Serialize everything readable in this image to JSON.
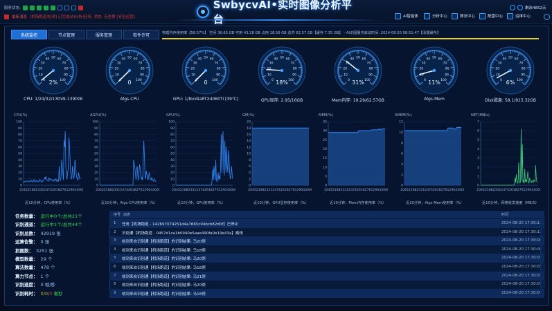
{
  "topbar": {
    "service_status_label": "服务状态:",
    "alarm_label": "最新消息",
    "alarm_text": "[机场跑道/检测] 已完成[AI分析]任务, 状态: 无告警 [安全运营]",
    "title": "SwbycvAI•实时图像分析平台",
    "nav": [
      {
        "label": "AI智能体",
        "icon": "robot-icon"
      },
      {
        "label": "分析中心",
        "icon": "chart-icon"
      },
      {
        "label": "算法中心",
        "icon": "algorithm-icon"
      },
      {
        "label": "配置中心",
        "icon": "settings-icon"
      },
      {
        "label": "运维中心",
        "icon": "monitor-icon"
      }
    ],
    "user_label": "剩余4852天",
    "help_icon": "help-icon",
    "power_icon": "power-icon"
  },
  "tabs": [
    "系统监控",
    "节点管理",
    "服务管理",
    "软件许可"
  ],
  "active_tab": 0,
  "info_line": "物理内存使用率【58.57%】 空闲 36.65 GB 可用 43.28 GB 占用 18.56 GB 总共 62.57 GB【缓存 7.35 GB】 - AI识图服务启动时间: 2024-08-20 08:51:47【清理缓存】",
  "gauges": [
    {
      "label": "CPU: 1/24/32/13thi9-13900K",
      "value": 2,
      "display": "2%"
    },
    {
      "label": "Algs-CPU",
      "value": 0,
      "display": "0"
    },
    {
      "label": "GPU: 1/NvidiaRTX4060Ti [39℃]",
      "value": 0,
      "display": "0"
    },
    {
      "label": "GPU显存: 2.95/16GB",
      "value": 18,
      "display": "18%"
    },
    {
      "label": "Mem内存: 19.29/62.57GB",
      "value": 31,
      "display": "31%"
    },
    {
      "label": "Algs-Mem",
      "value": 11,
      "display": "11%"
    },
    {
      "label": "Disk磁盘: 58.1/915.32GB",
      "value": 6,
      "display": "6%"
    }
  ],
  "gauge_ticks": [
    0,
    10,
    20,
    30,
    40,
    50,
    60,
    70,
    80,
    90,
    100
  ],
  "colors": {
    "accent": "#2e8bff",
    "line_blue": "#2f8cff",
    "line_green": "#3fd07a",
    "ok": "#39d353",
    "warn": "#f0a020",
    "danger": "#e04040"
  },
  "chart_data": [
    {
      "type": "line",
      "title": "CPU(%)",
      "xlabel": "近10分钟，CPU使用率（%）",
      "x_ticks": [
        "2045",
        "2188",
        "2331",
        "2474",
        "2618",
        "2761",
        "2904",
        "3000"
      ],
      "ylim": [
        0,
        100
      ],
      "y_ticks": [
        0,
        10,
        20,
        30,
        40,
        50,
        60,
        70,
        80,
        90,
        100
      ],
      "series": [
        {
          "values": [
            6,
            5,
            6,
            5,
            6,
            7,
            6,
            5,
            6,
            7,
            6,
            5,
            8,
            7,
            6,
            5,
            7,
            9,
            6,
            5,
            6,
            8,
            7,
            5,
            6,
            7,
            6,
            9,
            8,
            6,
            5,
            7,
            6,
            8,
            9,
            12,
            10,
            14,
            9,
            8,
            7,
            6,
            12,
            9,
            8,
            10,
            9,
            8,
            7,
            6,
            8,
            9,
            7,
            10,
            9,
            6,
            8,
            7,
            6,
            30,
            10,
            8,
            12,
            40,
            30,
            20,
            8,
            70,
            60,
            85,
            30,
            12,
            10,
            20,
            25,
            75,
            65,
            40,
            20,
            10,
            12,
            30,
            20,
            10,
            15,
            40,
            35,
            20,
            12,
            10,
            8,
            20,
            15,
            10,
            12
          ]
        }
      ]
    },
    {
      "type": "line",
      "title": "AGPU(%)",
      "xlabel": "近10分钟，Algs-CPU使用率（%）",
      "x_ticks": [
        "2045",
        "2188",
        "2331",
        "2474",
        "2618",
        "2761",
        "2904",
        "3000"
      ],
      "ylim": [
        0,
        100
      ],
      "y_ticks": [
        0,
        10,
        20,
        30,
        40,
        50,
        60,
        70,
        80,
        90,
        100
      ],
      "series": [
        {
          "values": [
            0,
            0,
            0,
            0,
            0,
            0,
            0,
            0,
            0,
            0,
            0,
            0,
            0,
            0,
            0,
            0,
            0,
            0,
            0,
            0,
            0,
            0,
            0,
            0,
            0,
            0,
            0,
            0,
            0,
            0,
            0,
            0,
            0,
            0,
            0,
            0,
            0,
            0,
            0,
            0,
            0,
            0,
            0,
            0,
            0,
            0,
            0,
            0,
            0,
            0,
            0,
            0,
            0,
            0,
            0,
            0,
            40,
            35,
            28,
            20,
            8,
            25,
            30,
            15,
            8,
            20,
            33,
            25,
            18,
            10,
            12,
            8,
            40,
            70,
            45,
            15,
            10,
            22,
            18,
            12,
            8,
            15,
            20,
            12,
            10,
            8,
            12,
            10,
            8,
            6,
            10,
            8,
            7,
            6,
            5
          ]
        }
      ]
    },
    {
      "type": "line",
      "title": "GPU(%)",
      "xlabel": "近10分钟，GPU使用率（%）",
      "x_ticks": [
        "2045",
        "2188",
        "2331",
        "2474",
        "2618",
        "2761",
        "2904",
        "3000"
      ],
      "ylim": [
        0,
        100
      ],
      "y_ticks": [
        0,
        10,
        20,
        30,
        40,
        50,
        60,
        70,
        80,
        90,
        100
      ],
      "series": [
        {
          "values": [
            0,
            0,
            0,
            0,
            0,
            0,
            0,
            0,
            0,
            0,
            0,
            0,
            0,
            0,
            0,
            0,
            0,
            0,
            0,
            0,
            0,
            0,
            0,
            0,
            0,
            0,
            0,
            0,
            0,
            0,
            0,
            0,
            0,
            0,
            0,
            0,
            0,
            0,
            0,
            0,
            0,
            0,
            0,
            0,
            0,
            0,
            0,
            0,
            0,
            0,
            0,
            0,
            0,
            0,
            0,
            0,
            0,
            0,
            0,
            0,
            10,
            25,
            8,
            30,
            20,
            8,
            40,
            10,
            5,
            12,
            20,
            8,
            15,
            10,
            30,
            80,
            20,
            60,
            85,
            30,
            15,
            70,
            40,
            20,
            60,
            30,
            20,
            55,
            40,
            20,
            10,
            15,
            30,
            18,
            10
          ]
        }
      ]
    },
    {
      "type": "area",
      "title": "GM(%)",
      "xlabel": "近10分钟，GPU显存使用率（%）",
      "x_ticks": [
        "2045",
        "2188",
        "2331",
        "2474",
        "2618",
        "2761",
        "2904",
        "3000"
      ],
      "ylim": [
        0,
        20
      ],
      "y_ticks": [
        0,
        2,
        4,
        6,
        8,
        10,
        12,
        14,
        16,
        18,
        20
      ],
      "series": [
        {
          "values": [
            18,
            18,
            18,
            18,
            18,
            18,
            18,
            18,
            18,
            18,
            18,
            18,
            18,
            18,
            18,
            18,
            18,
            18,
            18,
            18,
            18,
            18,
            18,
            18,
            18,
            18,
            18,
            18,
            18,
            18,
            18,
            18,
            18,
            18,
            18,
            18,
            18,
            18,
            18,
            18
          ]
        }
      ]
    },
    {
      "type": "area",
      "title": "MEM(%)",
      "xlabel": "近10分钟，Mem内存使用率（%）",
      "x_ticks": [
        "2045",
        "2188",
        "2331",
        "2474",
        "2618",
        "2761",
        "2904",
        "3000"
      ],
      "ylim": [
        0,
        35
      ],
      "y_ticks": [
        0,
        5,
        10,
        15,
        20,
        25,
        30,
        35
      ],
      "series": [
        {
          "values": [
            29,
            29,
            29,
            29,
            29,
            29,
            29,
            29,
            29,
            29,
            29,
            29,
            29,
            29,
            29,
            29,
            29,
            29,
            29,
            29,
            29,
            30,
            30,
            30,
            30,
            30,
            30,
            30,
            30,
            30,
            30.5,
            30.5,
            30.5,
            30.5,
            30.5,
            31,
            30.5,
            31,
            31,
            31
          ]
        }
      ]
    },
    {
      "type": "area",
      "title": "AMEM(%)",
      "xlabel": "近10分钟，Algs-Mem使用率（%）",
      "x_ticks": [
        "2045",
        "2188",
        "2331",
        "2474",
        "2618",
        "2761",
        "2904",
        "3000"
      ],
      "ylim": [
        0,
        12
      ],
      "y_ticks": [
        0,
        2,
        4,
        6,
        8,
        10,
        12
      ],
      "series": [
        {
          "values": [
            10.3,
            10.3,
            10.3,
            10.3,
            10.3,
            10.3,
            10.3,
            10.3,
            10.3,
            10.3,
            10.3,
            10.3,
            10.3,
            10.3,
            10.3,
            10.3,
            10.3,
            10.3,
            10.3,
            10.3,
            10.3,
            10.3,
            10.3,
            10.3,
            10.3,
            10.3,
            10.3,
            10.3,
            10.3,
            10.3,
            10.8,
            10.8,
            10.8,
            10.8,
            10.6,
            10.6,
            10.9,
            10.9,
            10.9,
            10.9
          ]
        }
      ]
    },
    {
      "type": "line",
      "title": "NET(MB/s)",
      "xlabel": "近10分钟，网络收发速度（MB/S）",
      "x_ticks": [
        "2045",
        "2188",
        "2331",
        "2474",
        "2618",
        "2761",
        "2904",
        "3000"
      ],
      "ylim": [
        0,
        7
      ],
      "y_ticks": [
        0,
        1,
        2,
        3,
        4,
        5,
        6,
        7
      ],
      "series": [
        {
          "name": "in",
          "values": [
            0,
            0,
            0,
            0,
            0,
            0,
            0,
            0,
            0,
            0,
            0,
            0,
            0,
            0,
            0,
            0,
            0,
            0,
            0,
            0,
            0,
            0,
            0,
            0,
            0,
            0,
            0,
            0,
            0,
            0,
            0,
            0,
            0,
            0,
            0,
            0,
            0,
            0,
            0,
            0,
            0,
            0,
            0,
            0,
            0,
            0,
            0,
            0,
            0,
            0,
            0,
            0,
            0,
            0,
            0,
            0,
            0.2,
            0.8,
            0.3,
            1.2,
            0.5,
            0.2,
            0.3,
            2.5,
            0.8,
            0.2,
            0.4,
            6.2,
            0.5,
            4.5,
            0.3,
            0.6,
            0.2,
            1.8,
            0.4,
            0.6,
            0.3,
            0.8,
            1.5,
            0.4,
            0.2,
            0.8,
            0.6,
            0.4,
            0.3,
            0.5,
            0.4,
            0.3,
            0.6,
            0.5,
            0.4,
            2.2,
            0.8,
            0.4,
            0.3
          ]
        }
      ]
    }
  ],
  "stats": [
    {
      "key": "任务数量：",
      "value": "运行中0个/总共21个",
      "style": "green"
    },
    {
      "key": "识别通道：",
      "value": "运行中1个/总共44个",
      "style": "green"
    },
    {
      "key": "识别总数：",
      "value": "42919 张",
      "style": "blue"
    },
    {
      "key": "运算告警：",
      "value": "0 张",
      "style": "blue"
    },
    {
      "key": "抓图数：",
      "value": "3251 张",
      "style": "blue"
    },
    {
      "key": "模型数量：",
      "value": "29 个",
      "style": "blue"
    },
    {
      "key": "算法数量：",
      "value": "478 个",
      "style": "blue"
    },
    {
      "key": "算力节点：",
      "value": "1 个",
      "style": "blue"
    },
    {
      "key": "识别速度：",
      "value": "0 帧/秒",
      "style": "blue"
    }
  ],
  "stat_latency": {
    "key": "识别耗时：",
    "v1": "0",
    "v2": "0",
    "v3": "0",
    "unit": "毫秒"
  },
  "log": {
    "headers": [
      "序号",
      "动态",
      "时间"
    ],
    "rows": [
      {
        "n": "1",
        "text": "任务【机场跑道 - 142697074251d4a7665c04bcb82d0f】已停止",
        "time": "2024-08-20 17:30:12"
      },
      {
        "n": "2",
        "text": "识别通【机场跑道 - 0457d1ca1b0940e5aae490fa0e19e43a】离线",
        "time": "2024-08-20 17:30:12"
      },
      {
        "n": "3",
        "text": "收到来自识别通【机场跑道】的识别结果: 马20例",
        "time": "2024-08-20 17:30:06"
      },
      {
        "n": "4",
        "text": "收到来自识别通【机场跑道】的识别结果: 马18例",
        "time": "2024-08-20 17:30:06"
      },
      {
        "n": "5",
        "text": "收到来自识别通【机场跑道】的识别结果: 马20例",
        "time": "2024-08-20 17:30:05"
      },
      {
        "n": "6",
        "text": "收到来自识别通【机场跑道】的识别结果: 马18例",
        "time": "2024-08-20 17:30:05"
      },
      {
        "n": "7",
        "text": "收到来自识别通【机场跑道】的识别结果: 马21例",
        "time": "2024-08-20 17:30:05"
      },
      {
        "n": "8",
        "text": "收到来自识别通【机场跑道】的识别结果: 马20例",
        "time": "2024-08-20 17:30:05"
      },
      {
        "n": "9",
        "text": "收到来自识别通【机场跑道】的识别结果: 马18例",
        "time": "2024-08-20 17:30:04"
      }
    ]
  }
}
